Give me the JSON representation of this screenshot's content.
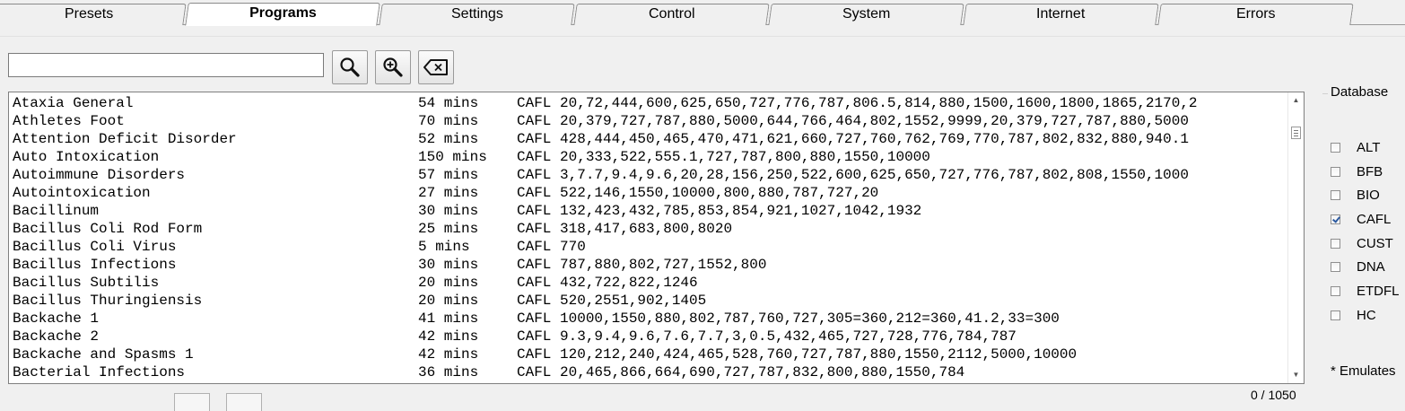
{
  "tabs": [
    {
      "label": "Presets"
    },
    {
      "label": "Programs"
    },
    {
      "label": "Settings"
    },
    {
      "label": "Control"
    },
    {
      "label": "System"
    },
    {
      "label": "Internet"
    },
    {
      "label": "Errors"
    }
  ],
  "active_tab": "Programs",
  "search": {
    "value": "",
    "placeholder": ""
  },
  "toolbar": {
    "search_icon": "magnifier-icon",
    "zoom_icon": "zoom-in-icon",
    "clear_icon": "backspace-clear-icon"
  },
  "programs": [
    {
      "name": "Ataxia General",
      "duration": "54 mins",
      "freqs": "CAFL 20,72,444,600,625,650,727,776,787,806.5,814,880,1500,1600,1800,1865,2170,2"
    },
    {
      "name": "Athletes Foot",
      "duration": "70 mins",
      "freqs": "CAFL 20,379,727,787,880,5000,644,766,464,802,1552,9999,20,379,727,787,880,5000"
    },
    {
      "name": "Attention Deficit Disorder",
      "duration": "52 mins",
      "freqs": "CAFL 428,444,450,465,470,471,621,660,727,760,762,769,770,787,802,832,880,940.1"
    },
    {
      "name": "Auto Intoxication",
      "duration": "150 mins",
      "freqs": "CAFL 20,333,522,555.1,727,787,800,880,1550,10000"
    },
    {
      "name": "Autoimmune Disorders",
      "duration": "57 mins",
      "freqs": "CAFL 3,7.7,9.4,9.6,20,28,156,250,522,600,625,650,727,776,787,802,808,1550,1000"
    },
    {
      "name": "Autointoxication",
      "duration": "27 mins",
      "freqs": "CAFL 522,146,1550,10000,800,880,787,727,20"
    },
    {
      "name": "Bacillinum",
      "duration": "30 mins",
      "freqs": "CAFL 132,423,432,785,853,854,921,1027,1042,1932"
    },
    {
      "name": "Bacillus Coli Rod Form",
      "duration": "25 mins",
      "freqs": "CAFL 318,417,683,800,8020"
    },
    {
      "name": "Bacillus Coli Virus",
      "duration": "5 mins",
      "freqs": "CAFL 770"
    },
    {
      "name": "Bacillus Infections",
      "duration": "30 mins",
      "freqs": "CAFL 787,880,802,727,1552,800"
    },
    {
      "name": "Bacillus Subtilis",
      "duration": "20 mins",
      "freqs": "CAFL 432,722,822,1246"
    },
    {
      "name": "Bacillus Thuringiensis",
      "duration": "20 mins",
      "freqs": "CAFL 520,2551,902,1405"
    },
    {
      "name": "Backache 1",
      "duration": "41 mins",
      "freqs": "CAFL 10000,1550,880,802,787,760,727,305=360,212=360,41.2,33=300"
    },
    {
      "name": "Backache 2",
      "duration": "42 mins",
      "freqs": "CAFL 9.3,9.4,9.6,7.6,7.7,3,0.5,432,465,727,728,776,784,787"
    },
    {
      "name": "Backache and Spasms 1",
      "duration": "42 mins",
      "freqs": "CAFL 120,212,240,424,465,528,760,727,787,880,1550,2112,5000,10000"
    },
    {
      "name": "Bacterial Infections",
      "duration": "36 mins",
      "freqs": "CAFL 20,465,866,664,690,727,787,832,800,880,1550,784"
    }
  ],
  "counter": "0 / 1050",
  "database": {
    "title": "Database",
    "items": [
      {
        "label": "ALT",
        "checked": false
      },
      {
        "label": "BFB",
        "checked": false
      },
      {
        "label": "BIO",
        "checked": false
      },
      {
        "label": "CAFL",
        "checked": true
      },
      {
        "label": "CUST",
        "checked": false
      },
      {
        "label": "DNA",
        "checked": false
      },
      {
        "label": "ETDFL",
        "checked": false
      },
      {
        "label": "HC",
        "checked": false
      }
    ],
    "footnote": "* Emulates"
  }
}
